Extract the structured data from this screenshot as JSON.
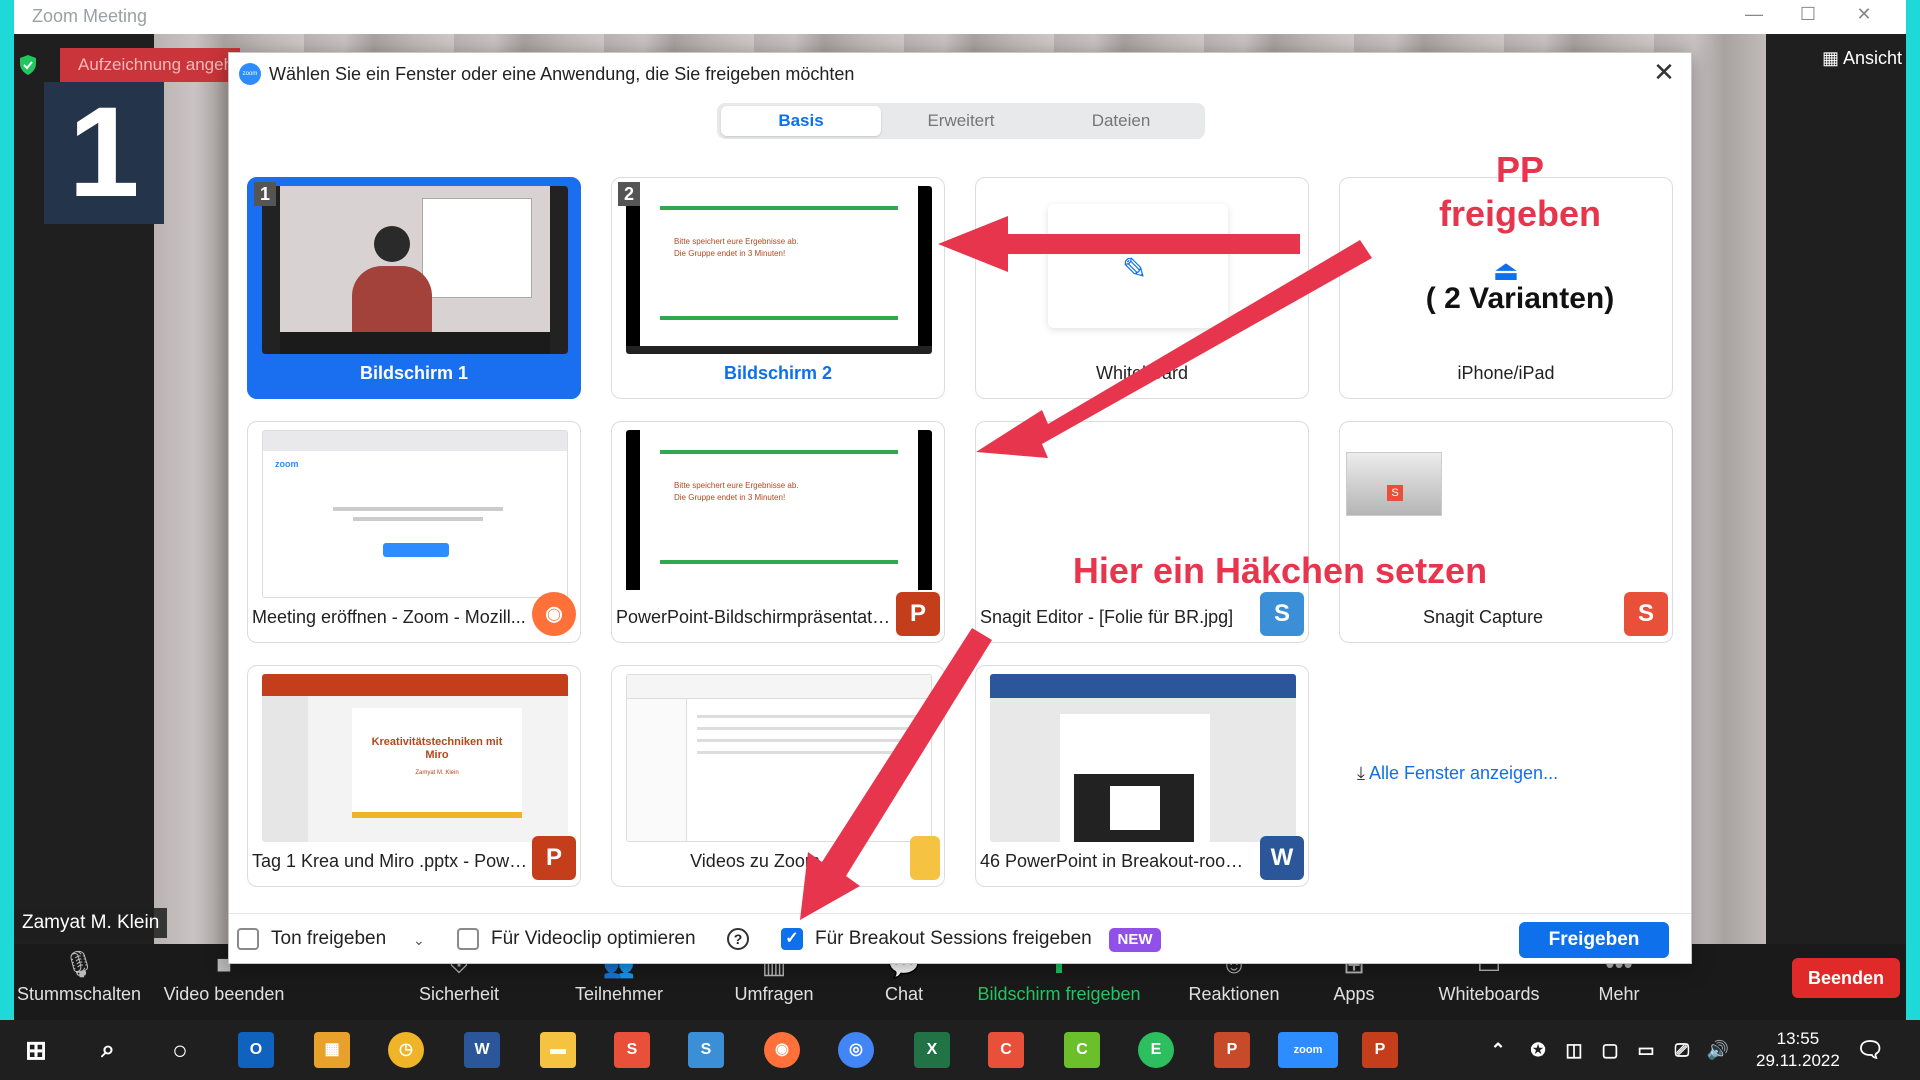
{
  "window": {
    "title": "Zoom Meeting"
  },
  "meeting": {
    "recording_text": "Aufzeichnung angehalten",
    "panel_number": "1",
    "view_label": "Ansicht",
    "participant_name": "Zamyat M. Klein"
  },
  "dialog": {
    "title": "Wählen Sie ein Fenster oder eine Anwendung, die Sie freigeben möchten",
    "tabs": [
      "Basis",
      "Erweitert",
      "Dateien"
    ],
    "tiles": [
      {
        "label": "Bildschirm 1",
        "number": "1"
      },
      {
        "label": "Bildschirm 2",
        "number": "2"
      },
      {
        "label": "Whiteboard"
      },
      {
        "label": "iPhone/iPad"
      },
      {
        "label": "Meeting eröffnen - Zoom - Mozill..."
      },
      {
        "label": "PowerPoint-Bildschirmpräsentatio..."
      },
      {
        "label": "Snagit Editor - [Folie für BR.jpg]"
      },
      {
        "label": "Snagit Capture"
      },
      {
        "label": "Tag 1 Krea und Miro .pptx - Powe..."
      },
      {
        "label": "Videos zu Zoom"
      },
      {
        "label": "46 PowerPoint in Breakout-rooms..."
      }
    ],
    "slide_lines": [
      "Bitte speichert eure Ergebnisse ab.",
      "Die Gruppe endet in 3 Minuten!"
    ],
    "ppt_thumb": {
      "title": "Kreativitätstechniken mit Miro",
      "author": "Zamyat M. Klein"
    },
    "show_all_windows": "Alle Fenster anzeigen...",
    "footer": {
      "share_sound": "Ton freigeben",
      "optimize_video": "Für Videoclip optimieren",
      "breakout_share": "Für Breakout Sessions freigeben",
      "new_badge": "NEW",
      "share_button": "Freigeben"
    }
  },
  "annotations": {
    "pp_line1": "PP",
    "pp_line2": "freigeben",
    "variants": "( 2 Varianten)",
    "checkbox_hint": "Hier ein Häkchen setzen",
    "color": "#e8354e"
  },
  "toolbar": {
    "items": [
      "Stummschalten",
      "Video beenden",
      "Sicherheit",
      "Teilnehmer",
      "Umfragen",
      "Chat",
      "Bildschirm freigeben",
      "Reaktionen",
      "Apps",
      "Whiteboards",
      "Mehr"
    ],
    "end_label": "Beenden"
  },
  "taskbar": {
    "time": "13:55",
    "date": "29.11.2022"
  },
  "colors": {
    "accent": "#0e71eb",
    "end": "#e02a2a",
    "share_green": "#22c55e",
    "bg": "#1fd8d8"
  }
}
